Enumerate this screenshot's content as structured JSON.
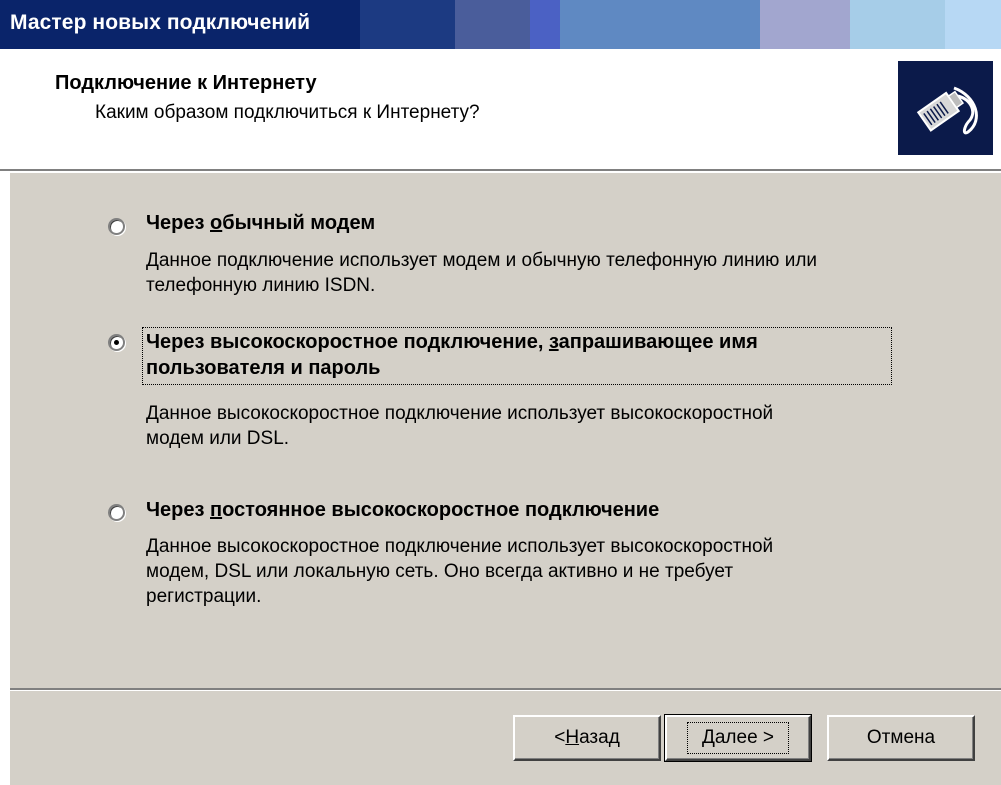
{
  "window": {
    "title": "Мастер новых подключений"
  },
  "header": {
    "title": "Подключение к Интернету",
    "subtitle": "Каким образом подключиться к Интернету?",
    "icon": "network-cable-icon"
  },
  "options": [
    {
      "label_pre": "Через ",
      "label_accel": "о",
      "label_post": "бычный модем",
      "label_line2": "",
      "desc_lines": [
        "Данное подключение использует модем и обычную телефонную линию или",
        "телефонную линию ISDN."
      ],
      "selected": false
    },
    {
      "label_pre": "Через высокоскоростное подключение, ",
      "label_accel": "з",
      "label_post": "апрашивающее имя",
      "label_line2": "пользователя и пароль",
      "desc_lines": [
        "Данное высокоскоростное подключение использует высокоскоростной",
        "модем или DSL."
      ],
      "selected": true
    },
    {
      "label_pre": "Через ",
      "label_accel": "п",
      "label_post": "остоянное высокоскоростное подключение",
      "label_line2": "",
      "desc_lines": [
        "Данное высокоскоростное подключение использует высокоскоростной",
        "модем, DSL или локальную сеть. Оно всегда активно и не требует",
        "регистрации."
      ],
      "selected": false
    }
  ],
  "buttons": {
    "back": {
      "pre": "< ",
      "accel": "Н",
      "post": "азад"
    },
    "next": {
      "pre": "",
      "accel": "Д",
      "post": "алее >"
    },
    "cancel": {
      "label": "Отмена"
    }
  },
  "colors": {
    "titlebar": "#0a246a",
    "dialog_face": "#d4d0c8",
    "header_icon_bg": "#0b1a4a"
  }
}
